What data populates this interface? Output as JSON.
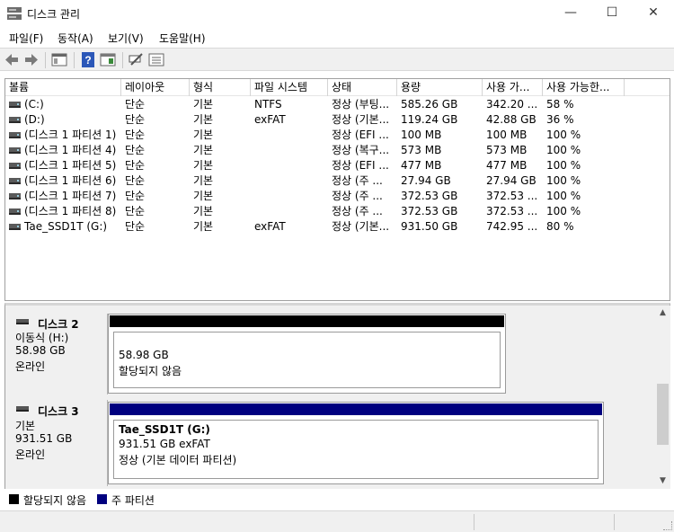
{
  "window": {
    "title": "디스크 관리",
    "controls": {
      "minimize": "—",
      "maximize": "☐",
      "close": "✕"
    }
  },
  "menu": [
    "파일(F)",
    "동작(A)",
    "보기(V)",
    "도움말(H)"
  ],
  "toolbar": {
    "icons": [
      "back-arrow-icon",
      "forward-arrow-icon",
      "console-tree-icon",
      "help-icon",
      "properties-icon",
      "connect-icon",
      "volume-list-icon"
    ]
  },
  "volume_list": {
    "columns": [
      "볼륨",
      "레이아웃",
      "형식",
      "파일 시스템",
      "상태",
      "용량",
      "사용 가...",
      "사용 가능한..."
    ],
    "rows": [
      [
        "(C:)",
        "단순",
        "기본",
        "NTFS",
        "정상 (부팅...",
        "585.26 GB",
        "342.20 ...",
        "58 %"
      ],
      [
        "(D:)",
        "단순",
        "기본",
        "exFAT",
        "정상 (기본...",
        "119.24 GB",
        "42.88 GB",
        "36 %"
      ],
      [
        "(디스크 1 파티션 1)",
        "단순",
        "기본",
        "",
        "정상 (EFI ...",
        "100 MB",
        "100 MB",
        "100 %"
      ],
      [
        "(디스크 1 파티션 4)",
        "단순",
        "기본",
        "",
        "정상 (복구...",
        "573 MB",
        "573 MB",
        "100 %"
      ],
      [
        "(디스크 1 파티션 5)",
        "단순",
        "기본",
        "",
        "정상 (EFI ...",
        "477 MB",
        "477 MB",
        "100 %"
      ],
      [
        "(디스크 1 파티션 6)",
        "단순",
        "기본",
        "",
        "정상 (주 ...",
        "27.94 GB",
        "27.94 GB",
        "100 %"
      ],
      [
        "(디스크 1 파티션 7)",
        "단순",
        "기본",
        "",
        "정상 (주 ...",
        "372.53 GB",
        "372.53 ...",
        "100 %"
      ],
      [
        "(디스크 1 파티션 8)",
        "단순",
        "기본",
        "",
        "정상 (주 ...",
        "372.53 GB",
        "372.53 ...",
        "100 %"
      ],
      [
        "Tae_SSD1T (G:)",
        "단순",
        "기본",
        "exFAT",
        "정상 (기본...",
        "931.50 GB",
        "742.95 ...",
        "80 %"
      ]
    ]
  },
  "disks": [
    {
      "name": "디스크 2",
      "type": "이동식 (H:)",
      "size": "58.98 GB",
      "status": "온라인",
      "partition": {
        "title": "",
        "line1": "58.98 GB",
        "line2": "할당되지 않음",
        "color": "#000000"
      }
    },
    {
      "name": "디스크 3",
      "type": "기본",
      "size": "931.51 GB",
      "status": "온라인",
      "partition": {
        "title": "Tae_SSD1T  (G:)",
        "line1": "931.51 GB exFAT",
        "line2": "정상 (기본 데이터 파티션)",
        "color": "#00007f"
      }
    }
  ],
  "legend": [
    {
      "label": "할당되지 않음",
      "color": "#000000"
    },
    {
      "label": "주 파티션",
      "color": "#00007f"
    }
  ]
}
